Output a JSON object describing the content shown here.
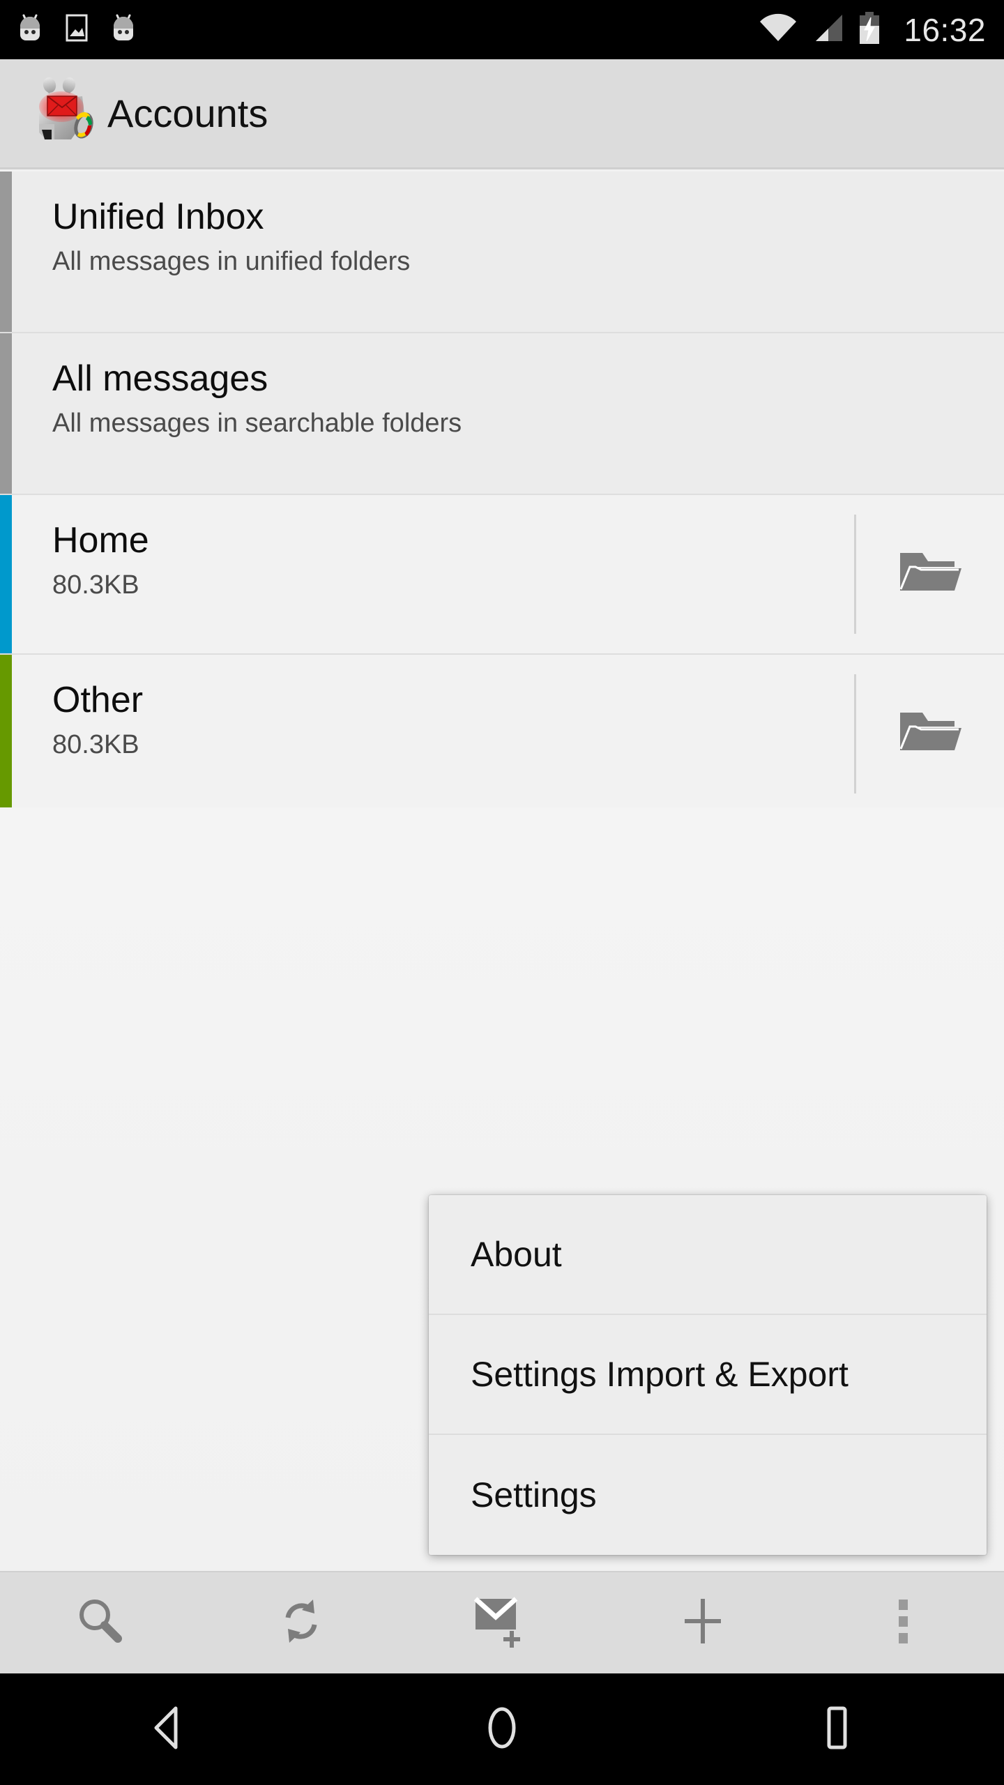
{
  "status_bar": {
    "time": "16:32",
    "left_icons": [
      "android-head-icon",
      "image-icon",
      "android-head-icon"
    ],
    "right_icons": [
      "wifi-icon",
      "cell-signal-icon",
      "battery-charging-icon"
    ],
    "background_color": "#000000",
    "text_color": "#e8e8e8"
  },
  "header": {
    "title": "Accounts",
    "logo_name": "k9-mail-dog-logo",
    "background_color": "#dcdcdc"
  },
  "accounts": {
    "items": [
      {
        "name": "Unified Inbox",
        "subtitle": "All messages in unified folders",
        "accent_color": "#999999",
        "has_folder_icon": false
      },
      {
        "name": "All messages",
        "subtitle": "All messages in searchable folders",
        "accent_color": "#999999",
        "has_folder_icon": false
      },
      {
        "name": "Home",
        "subtitle": "80.3KB",
        "accent_color": "#0099cc",
        "has_folder_icon": true
      },
      {
        "name": "Other",
        "subtitle": "80.3KB",
        "accent_color": "#669900",
        "has_folder_icon": true
      }
    ]
  },
  "popup_menu": {
    "items": [
      {
        "label": "About"
      },
      {
        "label": "Settings Import & Export"
      },
      {
        "label": "Settings"
      }
    ],
    "background_color": "#ededed"
  },
  "bottom_toolbar": {
    "buttons": [
      {
        "name": "search-icon",
        "label": "Search"
      },
      {
        "name": "refresh-icon",
        "label": "Refresh"
      },
      {
        "name": "compose-mail-icon",
        "label": "Compose"
      },
      {
        "name": "add-account-icon",
        "label": "Add account"
      },
      {
        "name": "overflow-menu-icon",
        "label": "More options"
      }
    ],
    "background_color": "#dcdcdc",
    "icon_color": "#7d7d7d"
  },
  "nav_bar": {
    "buttons": [
      {
        "name": "back-icon",
        "label": "Back"
      },
      {
        "name": "home-icon",
        "label": "Home"
      },
      {
        "name": "recents-icon",
        "label": "Recent apps"
      }
    ],
    "background_color": "#000000"
  }
}
